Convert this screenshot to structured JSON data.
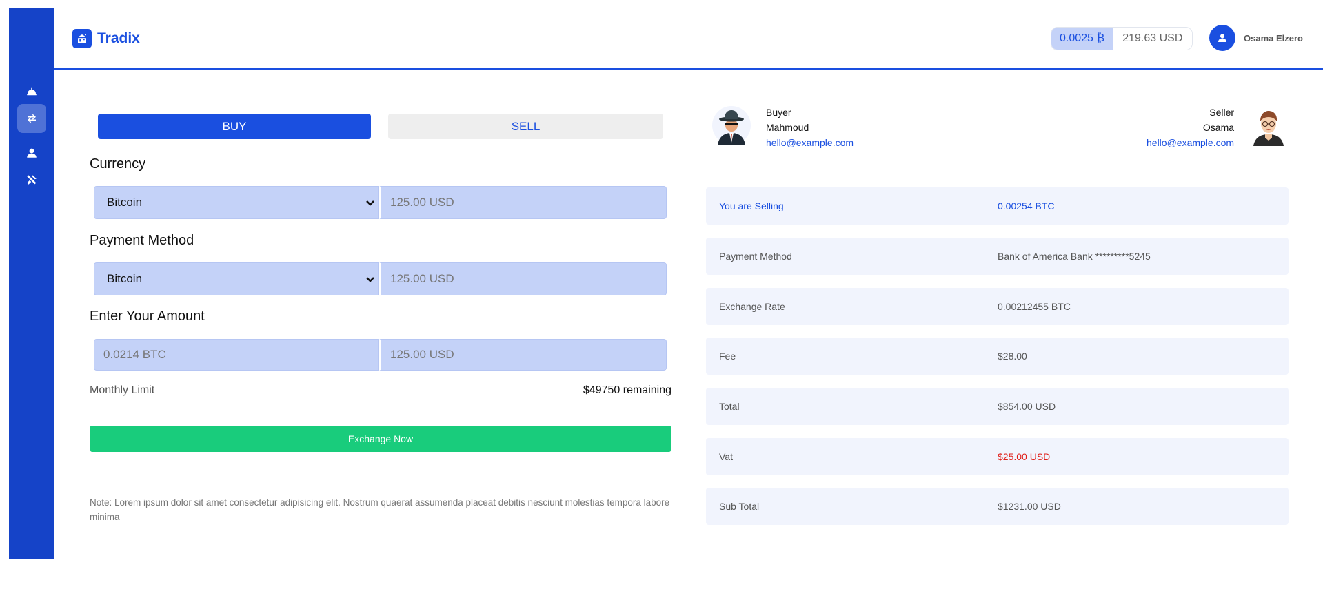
{
  "brand": {
    "name": "Tradix"
  },
  "header": {
    "balance_btc": "0.0025 ₿",
    "balance_usd": "219.63 USD",
    "user_name": "Osama Elzero"
  },
  "sidebar": {
    "items": [
      {
        "icon": "helmet-icon"
      },
      {
        "icon": "exchange-icon"
      },
      {
        "icon": "user-icon"
      },
      {
        "icon": "tools-icon"
      }
    ]
  },
  "tabs": {
    "buy": "BUY",
    "sell": "SELL"
  },
  "form": {
    "currency_label": "Currency",
    "currency_select": "Bitcoin",
    "currency_amount_placeholder": "125.00 USD",
    "payment_label": "Payment Method",
    "payment_select": "Bitcoin",
    "payment_amount_placeholder": "125.00 USD",
    "amount_label": "Enter Your Amount",
    "amount_btc_placeholder": "0.0214 BTC",
    "amount_usd_placeholder": "125.00 USD",
    "limit_label": "Monthly Limit",
    "limit_value": "$49750 remaining",
    "exchange_button": "Exchange Now",
    "note": "Note: Lorem ipsum dolor sit amet consectetur adipisicing elit. Nostrum quaerat assumenda placeat debitis nesciunt molestias tempora labore minima"
  },
  "buyer": {
    "role": "Buyer",
    "name": "Mahmoud",
    "email": "hello@example.com"
  },
  "seller": {
    "role": "Seller",
    "name": "Osama",
    "email": "hello@example.com"
  },
  "summary": [
    {
      "label": "You are Selling",
      "value": "0.00254 BTC"
    },
    {
      "label": "Payment Method",
      "value": "Bank of America Bank *********5245"
    },
    {
      "label": "Exchange Rate",
      "value": "0.00212455 BTC"
    },
    {
      "label": "Fee",
      "value": "$28.00"
    },
    {
      "label": "Total",
      "value": "$854.00 USD"
    },
    {
      "label": "Vat",
      "value": "$25.00 USD"
    },
    {
      "label": "Sub Total",
      "value": "$1231.00 USD"
    }
  ],
  "colors": {
    "primary": "#1a4fe0",
    "sidebar": "#1543c8",
    "success": "#19cc7c",
    "danger": "#e0201a"
  }
}
